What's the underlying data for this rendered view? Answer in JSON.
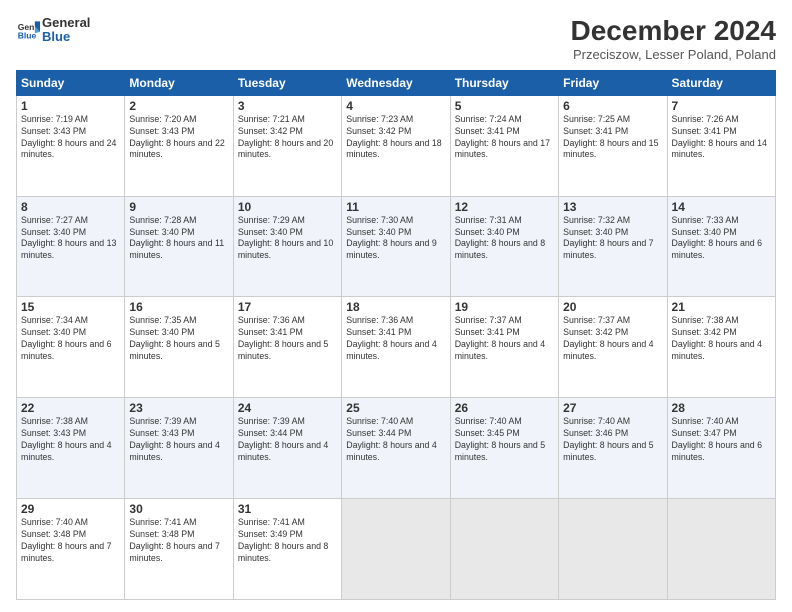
{
  "logo": {
    "line1": "General",
    "line2": "Blue"
  },
  "title": "December 2024",
  "location": "Przeciszow, Lesser Poland, Poland",
  "days_header": [
    "Sunday",
    "Monday",
    "Tuesday",
    "Wednesday",
    "Thursday",
    "Friday",
    "Saturday"
  ],
  "weeks": [
    [
      {
        "num": "1",
        "sunrise": "7:19 AM",
        "sunset": "3:43 PM",
        "daylight": "8 hours and 24 minutes."
      },
      {
        "num": "2",
        "sunrise": "7:20 AM",
        "sunset": "3:43 PM",
        "daylight": "8 hours and 22 minutes."
      },
      {
        "num": "3",
        "sunrise": "7:21 AM",
        "sunset": "3:42 PM",
        "daylight": "8 hours and 20 minutes."
      },
      {
        "num": "4",
        "sunrise": "7:23 AM",
        "sunset": "3:42 PM",
        "daylight": "8 hours and 18 minutes."
      },
      {
        "num": "5",
        "sunrise": "7:24 AM",
        "sunset": "3:41 PM",
        "daylight": "8 hours and 17 minutes."
      },
      {
        "num": "6",
        "sunrise": "7:25 AM",
        "sunset": "3:41 PM",
        "daylight": "8 hours and 15 minutes."
      },
      {
        "num": "7",
        "sunrise": "7:26 AM",
        "sunset": "3:41 PM",
        "daylight": "8 hours and 14 minutes."
      }
    ],
    [
      {
        "num": "8",
        "sunrise": "7:27 AM",
        "sunset": "3:40 PM",
        "daylight": "8 hours and 13 minutes."
      },
      {
        "num": "9",
        "sunrise": "7:28 AM",
        "sunset": "3:40 PM",
        "daylight": "8 hours and 11 minutes."
      },
      {
        "num": "10",
        "sunrise": "7:29 AM",
        "sunset": "3:40 PM",
        "daylight": "8 hours and 10 minutes."
      },
      {
        "num": "11",
        "sunrise": "7:30 AM",
        "sunset": "3:40 PM",
        "daylight": "8 hours and 9 minutes."
      },
      {
        "num": "12",
        "sunrise": "7:31 AM",
        "sunset": "3:40 PM",
        "daylight": "8 hours and 8 minutes."
      },
      {
        "num": "13",
        "sunrise": "7:32 AM",
        "sunset": "3:40 PM",
        "daylight": "8 hours and 7 minutes."
      },
      {
        "num": "14",
        "sunrise": "7:33 AM",
        "sunset": "3:40 PM",
        "daylight": "8 hours and 6 minutes."
      }
    ],
    [
      {
        "num": "15",
        "sunrise": "7:34 AM",
        "sunset": "3:40 PM",
        "daylight": "8 hours and 6 minutes."
      },
      {
        "num": "16",
        "sunrise": "7:35 AM",
        "sunset": "3:40 PM",
        "daylight": "8 hours and 5 minutes."
      },
      {
        "num": "17",
        "sunrise": "7:36 AM",
        "sunset": "3:41 PM",
        "daylight": "8 hours and 5 minutes."
      },
      {
        "num": "18",
        "sunrise": "7:36 AM",
        "sunset": "3:41 PM",
        "daylight": "8 hours and 4 minutes."
      },
      {
        "num": "19",
        "sunrise": "7:37 AM",
        "sunset": "3:41 PM",
        "daylight": "8 hours and 4 minutes."
      },
      {
        "num": "20",
        "sunrise": "7:37 AM",
        "sunset": "3:42 PM",
        "daylight": "8 hours and 4 minutes."
      },
      {
        "num": "21",
        "sunrise": "7:38 AM",
        "sunset": "3:42 PM",
        "daylight": "8 hours and 4 minutes."
      }
    ],
    [
      {
        "num": "22",
        "sunrise": "7:38 AM",
        "sunset": "3:43 PM",
        "daylight": "8 hours and 4 minutes."
      },
      {
        "num": "23",
        "sunrise": "7:39 AM",
        "sunset": "3:43 PM",
        "daylight": "8 hours and 4 minutes."
      },
      {
        "num": "24",
        "sunrise": "7:39 AM",
        "sunset": "3:44 PM",
        "daylight": "8 hours and 4 minutes."
      },
      {
        "num": "25",
        "sunrise": "7:40 AM",
        "sunset": "3:44 PM",
        "daylight": "8 hours and 4 minutes."
      },
      {
        "num": "26",
        "sunrise": "7:40 AM",
        "sunset": "3:45 PM",
        "daylight": "8 hours and 5 minutes."
      },
      {
        "num": "27",
        "sunrise": "7:40 AM",
        "sunset": "3:46 PM",
        "daylight": "8 hours and 5 minutes."
      },
      {
        "num": "28",
        "sunrise": "7:40 AM",
        "sunset": "3:47 PM",
        "daylight": "8 hours and 6 minutes."
      }
    ],
    [
      {
        "num": "29",
        "sunrise": "7:40 AM",
        "sunset": "3:48 PM",
        "daylight": "8 hours and 7 minutes."
      },
      {
        "num": "30",
        "sunrise": "7:41 AM",
        "sunset": "3:48 PM",
        "daylight": "8 hours and 7 minutes."
      },
      {
        "num": "31",
        "sunrise": "7:41 AM",
        "sunset": "3:49 PM",
        "daylight": "8 hours and 8 minutes."
      },
      null,
      null,
      null,
      null
    ]
  ]
}
